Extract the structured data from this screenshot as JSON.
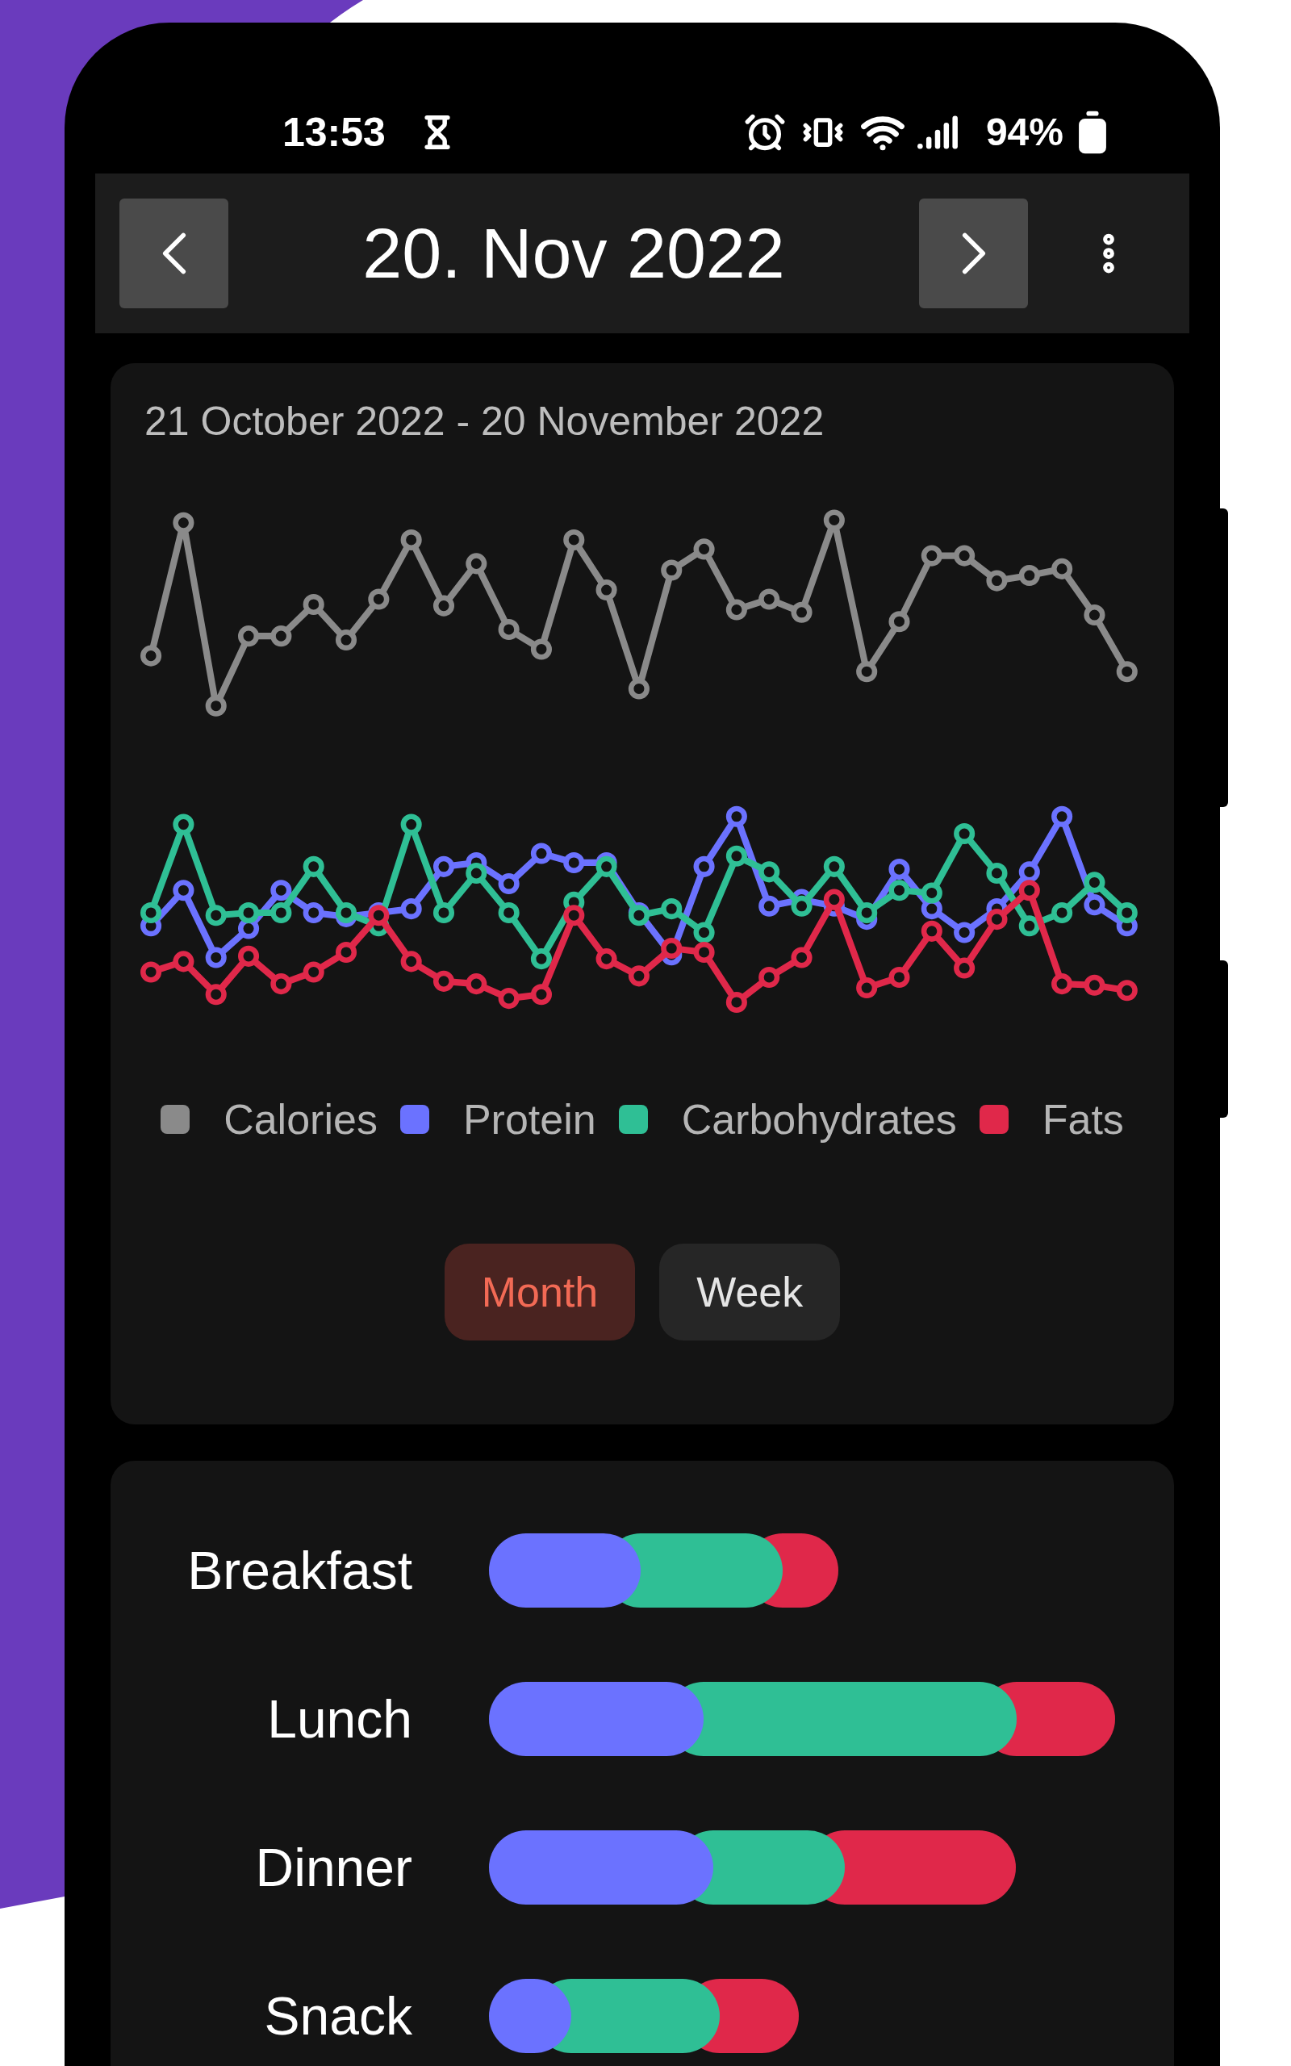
{
  "status_bar": {
    "time": "13:53",
    "battery": "94%"
  },
  "header": {
    "date": "20. Nov 2022"
  },
  "chart_card": {
    "range": "21 October 2022 - 20 November 2022",
    "legend": [
      {
        "label": "Calories",
        "color": "#8a8a8a"
      },
      {
        "label": "Protein",
        "color": "#6b72ff"
      },
      {
        "label": "Carbohydrates",
        "color": "#2fbf95"
      },
      {
        "label": "Fats",
        "color": "#e0284a"
      }
    ],
    "periods": [
      {
        "label": "Month",
        "selected": true
      },
      {
        "label": "Week",
        "selected": false
      }
    ]
  },
  "meals": [
    {
      "label": "Breakfast",
      "segments": [
        {
          "color": "#6b72ff"
        },
        {
          "color": "#2fbf95"
        },
        {
          "color": "#e0284a"
        }
      ]
    },
    {
      "label": "Lunch",
      "segments": [
        {
          "color": "#6b72ff"
        },
        {
          "color": "#2fbf95"
        },
        {
          "color": "#e0284a"
        }
      ]
    },
    {
      "label": "Dinner",
      "segments": [
        {
          "color": "#6b72ff"
        },
        {
          "color": "#2fbf95"
        },
        {
          "color": "#e0284a"
        }
      ]
    },
    {
      "label": "Snack",
      "segments": [
        {
          "color": "#6b72ff"
        },
        {
          "color": "#2fbf95"
        },
        {
          "color": "#e0284a"
        }
      ]
    }
  ]
}
